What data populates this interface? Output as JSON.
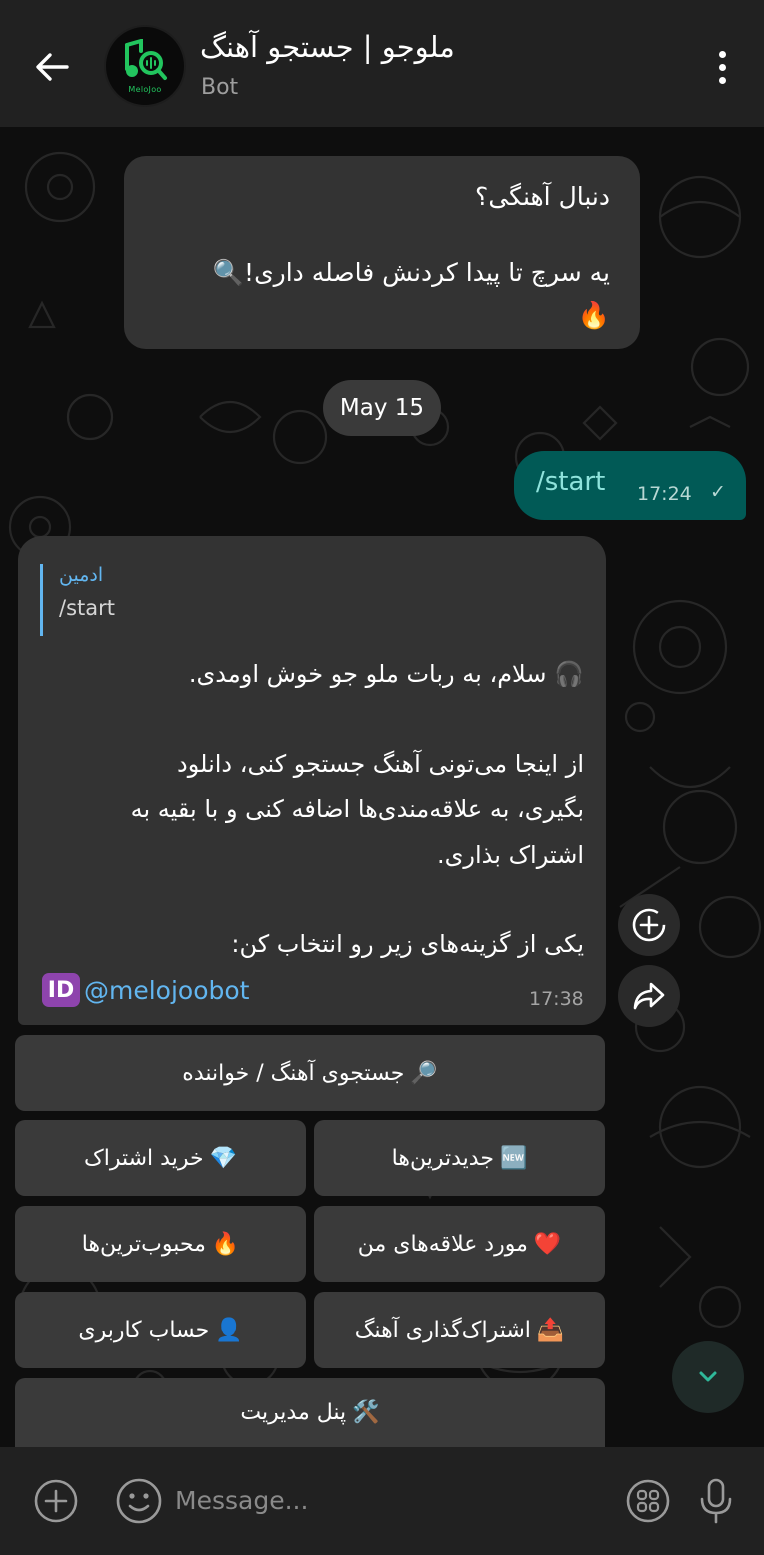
{
  "header": {
    "title": "ملوجو | جستجو آهنگ",
    "subtitle": "Bot",
    "avatar_text": "MeloJoo"
  },
  "messages": {
    "top": {
      "line1": "دنبال آهنگی؟",
      "line2": "یه سرچ تا پیدا کردنش فاصله داری!🔍",
      "line3": "🔥"
    },
    "date_separator": "May 15",
    "outgoing": {
      "text": "/start",
      "time": "17:24",
      "status": "✓"
    },
    "bot": {
      "reply_name": "ادمین",
      "reply_text": "/start",
      "line1": "🎧 سلام، به ربات ملو جو خوش اومدی.",
      "line2": "از اینجا می‌تونی آهنگ جستجو کنی، دانلود",
      "line3": "بگیری، به علاقه‌مندی‌ها اضافه کنی و با بقیه به",
      "line4": "اشتراک بذاری.",
      "line5": "یکی از گزینه‌های زیر رو انتخاب کن:",
      "id_badge": "ID",
      "handle": "@melojoobot",
      "time": "17:38"
    }
  },
  "keyboard": {
    "search": {
      "emoji": "🔎",
      "label": "جستجوی آهنگ / خواننده"
    },
    "buy": {
      "emoji": "💎",
      "label": "خرید اشتراک"
    },
    "newest": {
      "emoji": "🆕",
      "label": "جدیدترین‌ها"
    },
    "popular": {
      "emoji": "🔥",
      "label": "محبوب‌ترین‌ها"
    },
    "favorites": {
      "emoji": "❤️",
      "label": "مورد علاقه‌های من"
    },
    "account": {
      "emoji": "👤",
      "label": "حساب کاربری"
    },
    "share": {
      "emoji": "📤",
      "label": "اشتراک‌گذاری آهنگ"
    },
    "admin": {
      "emoji": "🛠️",
      "label": "پنل مدیریت"
    }
  },
  "input": {
    "placeholder": "Message..."
  },
  "colors": {
    "accent": "#62b6f0",
    "outgoing_bubble": "#015a56",
    "incoming_bubble": "#333333",
    "logo_green": "#22c55e"
  }
}
